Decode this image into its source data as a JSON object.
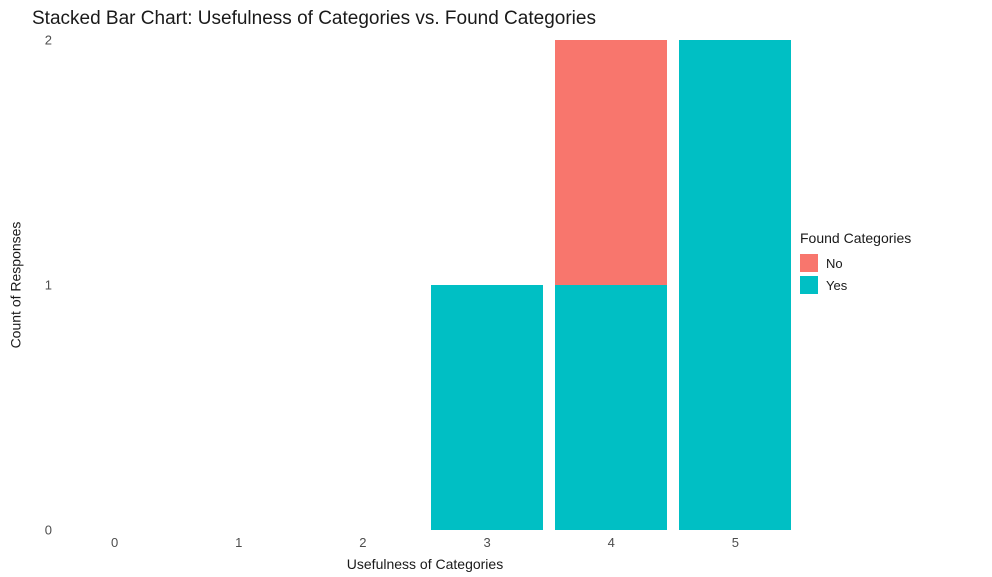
{
  "chart_data": {
    "type": "bar",
    "stacked": true,
    "title": "Stacked Bar Chart: Usefulness of Categories vs. Found Categories",
    "xlabel": "Usefulness of Categories",
    "ylabel": "Count of Responses",
    "xlim": [
      -0.4,
      5.4
    ],
    "ylim": [
      0,
      2
    ],
    "x_ticks": [
      0,
      1,
      2,
      3,
      4,
      5
    ],
    "y_ticks": [
      0,
      1,
      2
    ],
    "categories": [
      0,
      1,
      2,
      3,
      4,
      5
    ],
    "series": [
      {
        "name": "No",
        "color": "#f8766d",
        "values": [
          0,
          0,
          0,
          0,
          1,
          0
        ]
      },
      {
        "name": "Yes",
        "color": "#00bfc4",
        "values": [
          0,
          0,
          0,
          1,
          1,
          2
        ]
      }
    ],
    "legend_title": "Found Categories",
    "legend_items": [
      {
        "label": "No",
        "color": "#f8766d"
      },
      {
        "label": "Yes",
        "color": "#00bfc4"
      }
    ],
    "bar_width_frac": 0.9,
    "stack_order": [
      "Yes",
      "No"
    ]
  }
}
